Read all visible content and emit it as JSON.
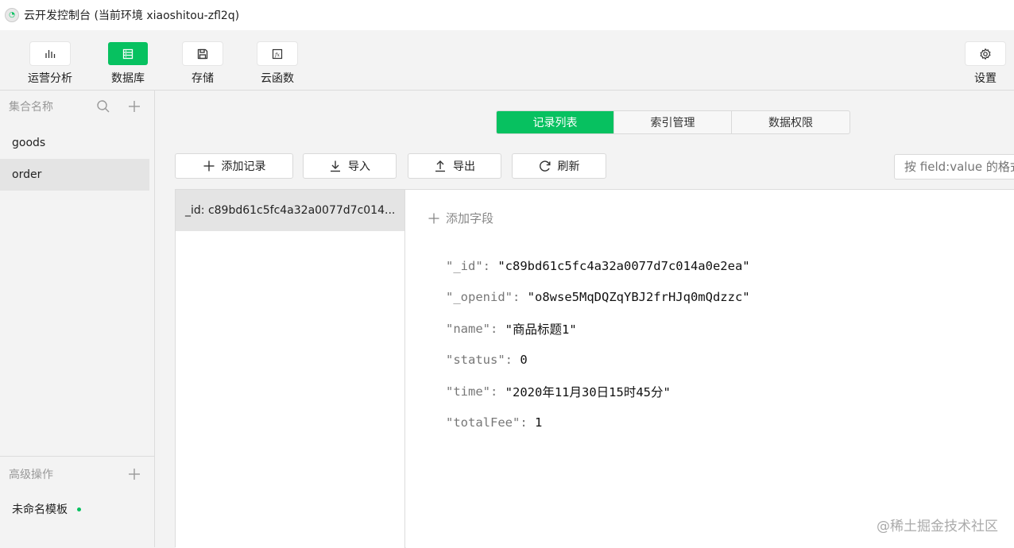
{
  "window": {
    "title": "云开发控制台 (当前环境 xiaoshitou-zfl2q)"
  },
  "toolbar": {
    "items": [
      {
        "label": "运营分析",
        "icon": "bar-chart-icon",
        "active": false
      },
      {
        "label": "数据库",
        "icon": "database-icon",
        "active": true
      },
      {
        "label": "存储",
        "icon": "storage-icon",
        "active": false
      },
      {
        "label": "云函数",
        "icon": "function-icon",
        "active": false
      }
    ],
    "settings_label": "设置"
  },
  "sidebar": {
    "header": "集合名称",
    "collections": [
      {
        "label": "goods"
      },
      {
        "label": "order"
      }
    ],
    "selected_collection": "order",
    "advanced_header": "高级操作",
    "templates": [
      {
        "label": "未命名模板"
      }
    ]
  },
  "tabs": [
    {
      "label": "记录列表",
      "active": true
    },
    {
      "label": "索引管理",
      "active": false
    },
    {
      "label": "数据权限",
      "active": false
    }
  ],
  "actions": {
    "add_record": "添加记录",
    "import": "导入",
    "export": "导出",
    "refresh": "刷新",
    "search_placeholder": "按 field:value 的格式"
  },
  "records": [
    {
      "label": "_id: c89bd61c5fc4a32a0077d7c014..."
    }
  ],
  "detail": {
    "add_field": "添加字段",
    "fields": [
      {
        "key": "\"_id\"",
        "value": "\"c89bd61c5fc4a32a0077d7c014a0e2ea\""
      },
      {
        "key": "\"_openid\"",
        "value": "\"o8wse5MqDQZqYBJ2frHJq0mQdzzc\""
      },
      {
        "key": "\"name\"",
        "value": "\"商品标题1\""
      },
      {
        "key": "\"status\"",
        "value": "0"
      },
      {
        "key": "\"time\"",
        "value": "\"2020年11月30日15时45分\""
      },
      {
        "key": "\"totalFee\"",
        "value": "1"
      }
    ]
  },
  "watermark": "@稀土掘金技术社区",
  "colors": {
    "accent": "#07c160",
    "background": "#f3f3f3"
  }
}
